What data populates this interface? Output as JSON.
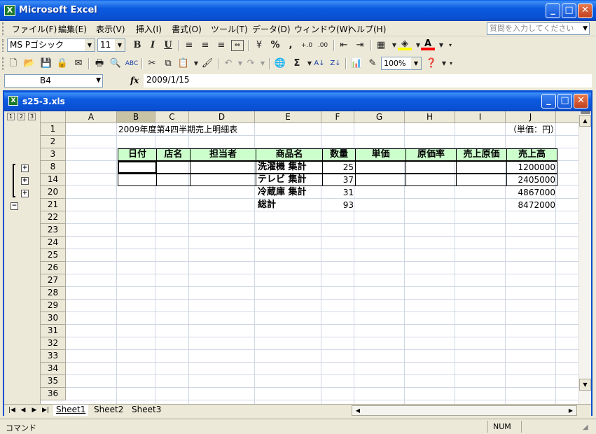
{
  "app": {
    "title": "Microsoft Excel",
    "icon": "excel-icon"
  },
  "menu": {
    "items": [
      "ファイル(F)",
      "編集(E)",
      "表示(V)",
      "挿入(I)",
      "書式(O)",
      "ツール(T)",
      "データ(D)",
      "ウィンドウ(W)",
      "ヘルプ(H)"
    ],
    "help_placeholder": "質問を入力してください"
  },
  "format_toolbar": {
    "font_name": "MS Pゴシック",
    "font_size": "11",
    "bold": "B",
    "italic": "I",
    "underline": "U",
    "percent": "%",
    "comma": ",",
    "font_color_glyph": "A"
  },
  "standard_toolbar": {
    "zoom": "100%",
    "sigma": "Σ"
  },
  "formula_bar": {
    "name_box": "B4",
    "fx": "fx",
    "content": "2009/1/15"
  },
  "workbook": {
    "title": "s25-3.xls"
  },
  "outline": {
    "levels": [
      "1",
      "2",
      "3"
    ]
  },
  "columns": [
    "A",
    "B",
    "C",
    "D",
    "E",
    "F",
    "G",
    "H",
    "I",
    "J"
  ],
  "selected_column": "B",
  "rows": [
    "1",
    "2",
    "3",
    "8",
    "14",
    "20",
    "21",
    "22",
    "23",
    "24",
    "25",
    "26",
    "27",
    "28",
    "29",
    "30",
    "31",
    "32",
    "33",
    "34",
    "35",
    "36"
  ],
  "cells": {
    "B1": "2009年度第4四半期売上明細表",
    "J1": "（単価：円）",
    "headers": [
      "日付",
      "店名",
      "担当者",
      "商品名",
      "数量",
      "単価",
      "原価率",
      "売上原価",
      "売上高"
    ],
    "summary": [
      {
        "name": "洗濯機 集計",
        "qty": "25",
        "sales": "1200000"
      },
      {
        "name": "テレビ 集計",
        "qty": "37",
        "sales": "2405000"
      },
      {
        "name": "冷蔵庫 集計",
        "qty": "31",
        "sales": "4867000"
      },
      {
        "name": "総計",
        "qty": "93",
        "sales": "8472000"
      }
    ]
  },
  "sheets": [
    "Sheet1",
    "Sheet2",
    "Sheet3"
  ],
  "active_sheet": "Sheet1",
  "status": {
    "mode": "コマンド",
    "num": "NUM"
  },
  "colors": {
    "titlebar": "#0a4fd0",
    "header_fill": "#ccffcc",
    "chrome": "#ece9d8"
  }
}
